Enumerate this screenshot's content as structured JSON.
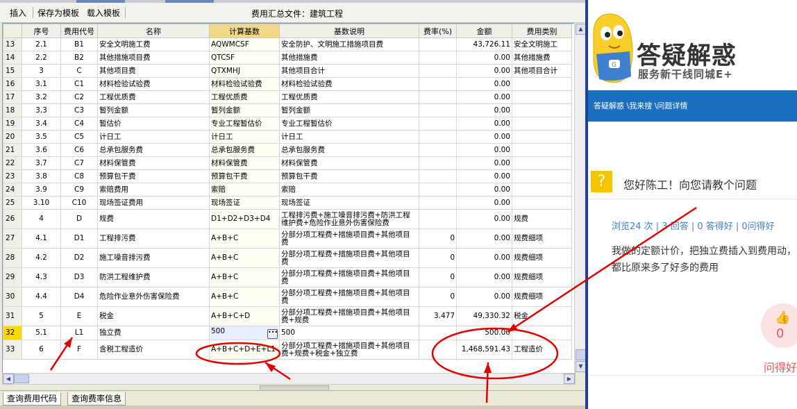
{
  "toolbar": {
    "insert": "插入",
    "save_template": "保存为模板",
    "load_template": "载入模板",
    "file_title": "费用汇总文件：建筑工程"
  },
  "table": {
    "headers": [
      "",
      "序号",
      "费用代号",
      "名称",
      "计算基数",
      "基数说明",
      "费率(%)",
      "金额",
      "费用类别"
    ],
    "rows": [
      [
        "13",
        "2.1",
        "B1",
        "安全文明施工费",
        "AQWMCSF",
        "安全防护、文明施工措施项目费",
        "",
        "43,726.11",
        "安全文明施工"
      ],
      [
        "14",
        "2.2",
        "B2",
        "其他措施项目费",
        "QTCSF",
        "其他措施费",
        "",
        "0.00",
        "其他措施费"
      ],
      [
        "15",
        "3",
        "C",
        "其他项目费",
        "QTXMHJ",
        "其他项目合计",
        "",
        "0.00",
        "其他项目合计"
      ],
      [
        "16",
        "3.1",
        "C1",
        "材料检验试验费",
        "材料检验试验费",
        "材料检验试验费",
        "",
        "0.00",
        ""
      ],
      [
        "17",
        "3.2",
        "C2",
        "工程优质费",
        "工程优质费",
        "工程优质费",
        "",
        "0.00",
        ""
      ],
      [
        "18",
        "3.3",
        "C3",
        "暂列金额",
        "暂列金额",
        "暂列金额",
        "",
        "0.00",
        ""
      ],
      [
        "19",
        "3.4",
        "C4",
        "暂估价",
        "专业工程暂估价",
        "专业工程暂估价",
        "",
        "0.00",
        ""
      ],
      [
        "20",
        "3.5",
        "C5",
        "计日工",
        "计日工",
        "计日工",
        "",
        "0.00",
        ""
      ],
      [
        "21",
        "3.6",
        "C6",
        "总承包服务费",
        "总承包服务费",
        "总承包服务费",
        "",
        "0.00",
        ""
      ],
      [
        "22",
        "3.7",
        "C7",
        "材料保管费",
        "材料保管费",
        "材料保管费",
        "",
        "0.00",
        ""
      ],
      [
        "23",
        "3.8",
        "C8",
        "预算包干费",
        "预算包干费",
        "预算包干费",
        "",
        "0.00",
        ""
      ],
      [
        "24",
        "3.9",
        "C9",
        "索赔费用",
        "索赔",
        "索赔",
        "",
        "0.00",
        ""
      ],
      [
        "25",
        "3.10",
        "C10",
        "现场签证费用",
        "现场签证",
        "现场签证",
        "",
        "0.00",
        ""
      ],
      [
        "26",
        "4",
        "D",
        "规费",
        "D1+D2+D3+D4",
        "工程排污费+施工噪音排污费+防洪工程维护费+危险作业意外伤害保险费",
        "",
        "0.00",
        "规费"
      ],
      [
        "27",
        "4.1",
        "D1",
        "工程排污费",
        "A+B+C",
        "分部分项工程费+措施项目费+其他项目费",
        "0",
        "0.00",
        "规费细项"
      ],
      [
        "28",
        "4.2",
        "D2",
        "施工噪音排污费",
        "A+B+C",
        "分部分项工程费+措施项目费+其他项目费",
        "0",
        "0.00",
        "规费细项"
      ],
      [
        "29",
        "4.3",
        "D3",
        "防洪工程维护费",
        "A+B+C",
        "分部分项工程费+措施项目费+其他项目费",
        "0",
        "0.00",
        "规费细项"
      ],
      [
        "30",
        "4.4",
        "D4",
        "危险作业意外伤害保险费",
        "A+B+C",
        "分部分项工程费+措施项目费+其他项目费",
        "0",
        "0.00",
        "规费细项"
      ],
      [
        "31",
        "5",
        "E",
        "税金",
        "A+B+C+D",
        "分部分项工程费+措施项目费+其他项目费+规费",
        "3.477",
        "49,330.32",
        "税金"
      ],
      [
        "32",
        "5.1",
        "L1",
        "独立费",
        "500",
        "500",
        "",
        "500.00",
        ""
      ],
      [
        "33",
        "6",
        "F",
        "含税工程造价",
        "A+B+C+D+E+L1",
        "分部分项工程费+措施项目费+其他项目费+规费+税金+独立费",
        "",
        "1,468,591.43",
        "工程造价"
      ]
    ]
  },
  "bottom_tabs": [
    "查询费用代码",
    "查询费率信息"
  ],
  "web": {
    "brand": "答疑解惑",
    "slogan": "服务新干线同城E+",
    "breadcrumb": "答疑解惑 \\我来搜 \\问题详情",
    "question_title": "您好陈工！向您请教个问题",
    "stats": "浏览24 次 | 3 回答 | 0 答得好 | 0问得好",
    "body": "我做的定额计价，把独立费插入到费用动，都比原来多了好多的费用",
    "like_count": "0",
    "helpful_label": "问得好"
  },
  "colors": {
    "nav_blue": "#1b6fbf",
    "header_highlight": "#f3d987",
    "selected_row": "#ffd700",
    "annotation_red": "#e00000"
  }
}
